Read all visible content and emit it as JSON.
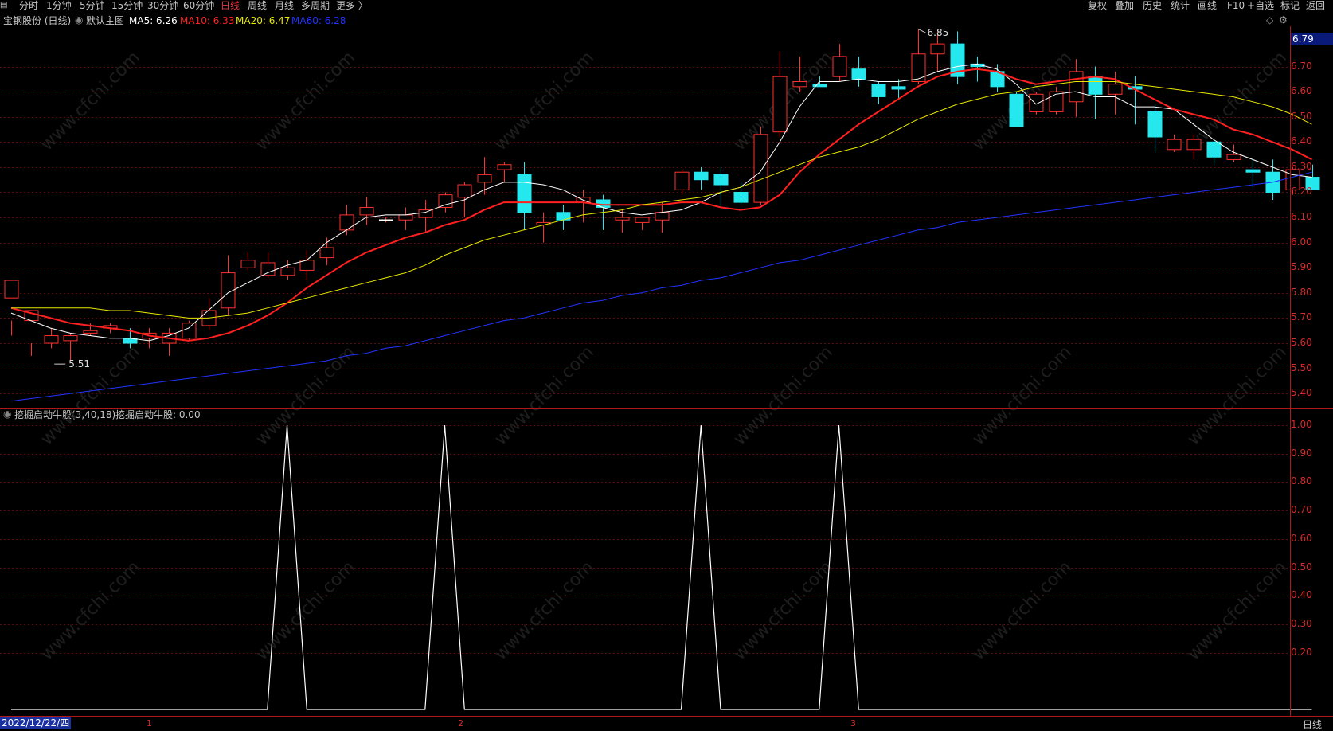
{
  "toolbar": {
    "left": [
      {
        "label": "分时",
        "active": false
      },
      {
        "label": "1分钟",
        "active": false
      },
      {
        "label": "5分钟",
        "active": false
      },
      {
        "label": "15分钟",
        "active": false
      },
      {
        "label": "30分钟",
        "active": false
      },
      {
        "label": "60分钟",
        "active": false
      },
      {
        "label": "日线",
        "active": true
      },
      {
        "label": "周线",
        "active": false
      },
      {
        "label": "月线",
        "active": false
      },
      {
        "label": "多周期",
        "active": false
      },
      {
        "label": "更多 〉",
        "active": false
      }
    ],
    "right": [
      "复权",
      "叠加",
      "历史",
      "统计",
      "画线",
      "F10",
      "+自选",
      "标记",
      "返回"
    ]
  },
  "main_header": {
    "stock": "宝钢股份 (日线)",
    "template": "默认主图",
    "ma5": "MA5: 6.26",
    "ma10": "MA10: 6.33",
    "ma20": "MA20: 6.47",
    "ma60": "MA60: 6.28",
    "colors": {
      "ma5": "#ffffff",
      "ma10": "#ff2020",
      "ma20": "#e8e800",
      "ma60": "#2233ff"
    }
  },
  "last_price": "6.79",
  "annotations": {
    "high": "6.85",
    "low": "5.51"
  },
  "sub_header": {
    "indicator": "挖掘启动牛股(3,40,18)",
    "value": "挖掘启动牛股: 0.00"
  },
  "right_label": "日线",
  "date_label": "2022/12/22/四",
  "x_ticks": [
    "1",
    "2",
    "3"
  ],
  "watermark": "www.cfchi.com",
  "chart_data": [
    {
      "type": "candlestick",
      "y_ticks": [
        "6.70",
        "6.60",
        "6.50",
        "6.40",
        "6.30",
        "6.20",
        "6.10",
        "6.00",
        "5.90",
        "5.80",
        "5.70",
        "5.60",
        "5.50",
        "5.40"
      ],
      "ylim": [
        5.35,
        6.86
      ],
      "candles": [
        [
          5.78,
          5.85,
          5.69,
          5.63
        ],
        [
          5.69,
          5.73,
          5.6,
          5.55
        ],
        [
          5.6,
          5.63,
          5.66,
          5.58
        ],
        [
          5.61,
          5.63,
          5.64,
          5.53
        ],
        [
          5.64,
          5.65,
          5.68,
          5.63
        ],
        [
          5.66,
          5.67,
          5.68,
          5.64
        ],
        [
          5.62,
          5.6,
          5.66,
          5.58
        ],
        [
          5.62,
          5.64,
          5.66,
          5.58
        ],
        [
          5.6,
          5.64,
          5.66,
          5.55
        ],
        [
          5.62,
          5.68,
          5.69,
          5.61
        ],
        [
          5.67,
          5.73,
          5.78,
          5.65
        ],
        [
          5.74,
          5.88,
          5.95,
          5.71
        ],
        [
          5.9,
          5.93,
          5.96,
          5.89
        ],
        [
          5.87,
          5.92,
          5.96,
          5.86
        ],
        [
          5.87,
          5.9,
          5.93,
          5.85
        ],
        [
          5.89,
          5.93,
          5.97,
          5.85
        ],
        [
          5.94,
          5.98,
          6.02,
          5.91
        ],
        [
          6.05,
          6.11,
          6.15,
          6.03
        ],
        [
          6.11,
          6.14,
          6.18,
          6.07
        ],
        [
          6.09,
          6.09,
          6.1,
          6.08
        ],
        [
          6.09,
          6.11,
          6.14,
          6.05
        ],
        [
          6.1,
          6.13,
          6.17,
          6.04
        ],
        [
          6.14,
          6.19,
          6.2,
          6.12
        ],
        [
          6.18,
          6.23,
          6.24,
          6.1
        ],
        [
          6.24,
          6.27,
          6.34,
          6.19
        ],
        [
          6.29,
          6.31,
          6.32,
          6.24
        ],
        [
          6.27,
          6.12,
          6.32,
          6.05
        ],
        [
          6.07,
          6.08,
          6.12,
          6.0
        ],
        [
          6.12,
          6.09,
          6.15,
          6.05
        ],
        [
          6.16,
          6.18,
          6.21,
          6.08
        ],
        [
          6.17,
          6.14,
          6.19,
          6.05
        ],
        [
          6.09,
          6.1,
          6.13,
          6.04
        ],
        [
          6.08,
          6.1,
          6.1,
          6.05
        ],
        [
          6.09,
          6.12,
          6.16,
          6.04
        ],
        [
          6.21,
          6.28,
          6.29,
          6.19
        ],
        [
          6.28,
          6.25,
          6.3,
          6.21
        ],
        [
          6.27,
          6.23,
          6.3,
          6.14
        ],
        [
          6.2,
          6.16,
          6.24,
          6.15
        ],
        [
          6.16,
          6.43,
          6.46,
          6.15
        ],
        [
          6.44,
          6.66,
          6.76,
          6.42
        ],
        [
          6.62,
          6.64,
          6.74,
          6.6
        ],
        [
          6.63,
          6.62,
          6.66,
          6.62
        ],
        [
          6.66,
          6.74,
          6.79,
          6.64
        ],
        [
          6.69,
          6.65,
          6.74,
          6.62
        ],
        [
          6.63,
          6.58,
          6.64,
          6.55
        ],
        [
          6.62,
          6.61,
          6.65,
          6.57
        ],
        [
          6.64,
          6.75,
          6.85,
          6.63
        ],
        [
          6.75,
          6.79,
          6.84,
          6.68
        ],
        [
          6.79,
          6.66,
          6.84,
          6.63
        ],
        [
          6.71,
          6.7,
          6.74,
          6.64
        ],
        [
          6.68,
          6.62,
          6.71,
          6.6
        ],
        [
          6.59,
          6.46,
          6.6,
          6.46
        ],
        [
          6.52,
          6.59,
          6.6,
          6.51
        ],
        [
          6.52,
          6.6,
          6.62,
          6.51
        ],
        [
          6.56,
          6.68,
          6.73,
          6.5
        ],
        [
          6.66,
          6.59,
          6.7,
          6.49
        ],
        [
          6.59,
          6.63,
          6.68,
          6.51
        ],
        [
          6.62,
          6.61,
          6.66,
          6.47
        ],
        [
          6.52,
          6.42,
          6.55,
          6.36
        ],
        [
          6.37,
          6.41,
          6.43,
          6.36
        ],
        [
          6.37,
          6.41,
          6.43,
          6.33
        ],
        [
          6.4,
          6.34,
          6.41,
          6.31
        ],
        [
          6.33,
          6.35,
          6.39,
          6.32
        ],
        [
          6.29,
          6.28,
          6.33,
          6.22
        ],
        [
          6.28,
          6.2,
          6.33,
          6.17
        ],
        [
          6.21,
          6.29,
          6.3,
          6.19
        ],
        [
          6.26,
          6.21,
          6.31,
          6.22
        ]
      ],
      "series": [
        {
          "name": "MA5",
          "color": "#ffffff",
          "width": 1,
          "values": [
            5.72,
            5.69,
            5.66,
            5.64,
            5.63,
            5.62,
            5.62,
            5.61,
            5.63,
            5.66,
            5.73,
            5.8,
            5.84,
            5.88,
            5.91,
            5.93,
            6.0,
            6.05,
            6.1,
            6.11,
            6.11,
            6.12,
            6.15,
            6.17,
            6.21,
            6.24,
            6.24,
            6.23,
            6.21,
            6.17,
            6.14,
            6.12,
            6.11,
            6.12,
            6.13,
            6.16,
            6.2,
            6.22,
            6.28,
            6.4,
            6.54,
            6.64,
            6.64,
            6.65,
            6.64,
            6.64,
            6.65,
            6.68,
            6.7,
            6.71,
            6.69,
            6.63,
            6.55,
            6.59,
            6.6,
            6.58,
            6.58,
            6.54,
            6.54,
            6.53,
            6.47,
            6.41,
            6.36,
            6.33,
            6.3,
            6.27,
            6.26
          ]
        },
        {
          "name": "MA10",
          "color": "#ff2020",
          "width": 2,
          "values": [
            5.74,
            5.72,
            5.7,
            5.68,
            5.67,
            5.66,
            5.65,
            5.63,
            5.62,
            5.61,
            5.62,
            5.64,
            5.67,
            5.71,
            5.76,
            5.82,
            5.87,
            5.92,
            5.96,
            5.99,
            6.02,
            6.04,
            6.07,
            6.09,
            6.13,
            6.16,
            6.16,
            6.16,
            6.16,
            6.16,
            6.15,
            6.15,
            6.15,
            6.15,
            6.16,
            6.16,
            6.14,
            6.13,
            6.14,
            6.19,
            6.28,
            6.35,
            6.41,
            6.47,
            6.52,
            6.57,
            6.62,
            6.66,
            6.68,
            6.69,
            6.68,
            6.65,
            6.63,
            6.64,
            6.65,
            6.66,
            6.65,
            6.61,
            6.57,
            6.53,
            6.51,
            6.49,
            6.45,
            6.43,
            6.4,
            6.37,
            6.33
          ]
        },
        {
          "name": "MA20",
          "color": "#e8e800",
          "width": 1,
          "values": [
            5.74,
            5.74,
            5.74,
            5.74,
            5.74,
            5.73,
            5.73,
            5.72,
            5.71,
            5.7,
            5.7,
            5.71,
            5.72,
            5.74,
            5.76,
            5.78,
            5.8,
            5.82,
            5.84,
            5.86,
            5.88,
            5.91,
            5.95,
            5.98,
            6.01,
            6.03,
            6.05,
            6.07,
            6.09,
            6.11,
            6.12,
            6.13,
            6.15,
            6.16,
            6.17,
            6.18,
            6.2,
            6.22,
            6.25,
            6.28,
            6.31,
            6.34,
            6.36,
            6.38,
            6.41,
            6.45,
            6.49,
            6.52,
            6.55,
            6.57,
            6.59,
            6.6,
            6.62,
            6.63,
            6.64,
            6.64,
            6.64,
            6.63,
            6.62,
            6.61,
            6.6,
            6.59,
            6.58,
            6.56,
            6.54,
            6.51,
            6.47
          ]
        },
        {
          "name": "MA60",
          "color": "#2233ff",
          "width": 1,
          "values": [
            5.37,
            5.38,
            5.39,
            5.4,
            5.41,
            5.42,
            5.43,
            5.44,
            5.45,
            5.46,
            5.47,
            5.48,
            5.49,
            5.5,
            5.51,
            5.52,
            5.53,
            5.55,
            5.56,
            5.58,
            5.59,
            5.61,
            5.63,
            5.65,
            5.67,
            5.69,
            5.7,
            5.72,
            5.74,
            5.76,
            5.77,
            5.79,
            5.8,
            5.82,
            5.83,
            5.85,
            5.86,
            5.88,
            5.9,
            5.92,
            5.93,
            5.95,
            5.97,
            5.99,
            6.01,
            6.03,
            6.05,
            6.06,
            6.08,
            6.09,
            6.1,
            6.11,
            6.12,
            6.13,
            6.14,
            6.15,
            6.16,
            6.17,
            6.18,
            6.19,
            6.2,
            6.21,
            6.22,
            6.23,
            6.24,
            6.26,
            6.28
          ]
        }
      ]
    },
    {
      "type": "line",
      "y_ticks": [
        "1.00",
        "0.90",
        "0.80",
        "0.70",
        "0.60",
        "0.50",
        "0.40",
        "0.30",
        "0.20"
      ],
      "ylim": [
        0,
        1
      ],
      "series": [
        {
          "name": "挖掘启动牛股",
          "color": "#ffffff",
          "values": [
            0,
            0,
            0,
            0,
            0,
            0,
            0,
            0,
            0,
            0,
            0,
            0,
            0,
            0,
            1,
            0,
            0,
            0,
            0,
            0,
            0,
            0,
            1,
            0,
            0,
            0,
            0,
            0,
            0,
            0,
            0,
            0,
            0,
            0,
            0,
            1,
            0,
            0,
            0,
            0,
            0,
            0,
            1,
            0,
            0,
            0,
            0,
            0,
            0,
            0,
            0,
            0,
            0,
            0,
            0,
            0,
            0,
            0,
            0,
            0,
            0,
            0,
            0,
            0,
            0,
            0,
            0
          ]
        }
      ]
    }
  ]
}
